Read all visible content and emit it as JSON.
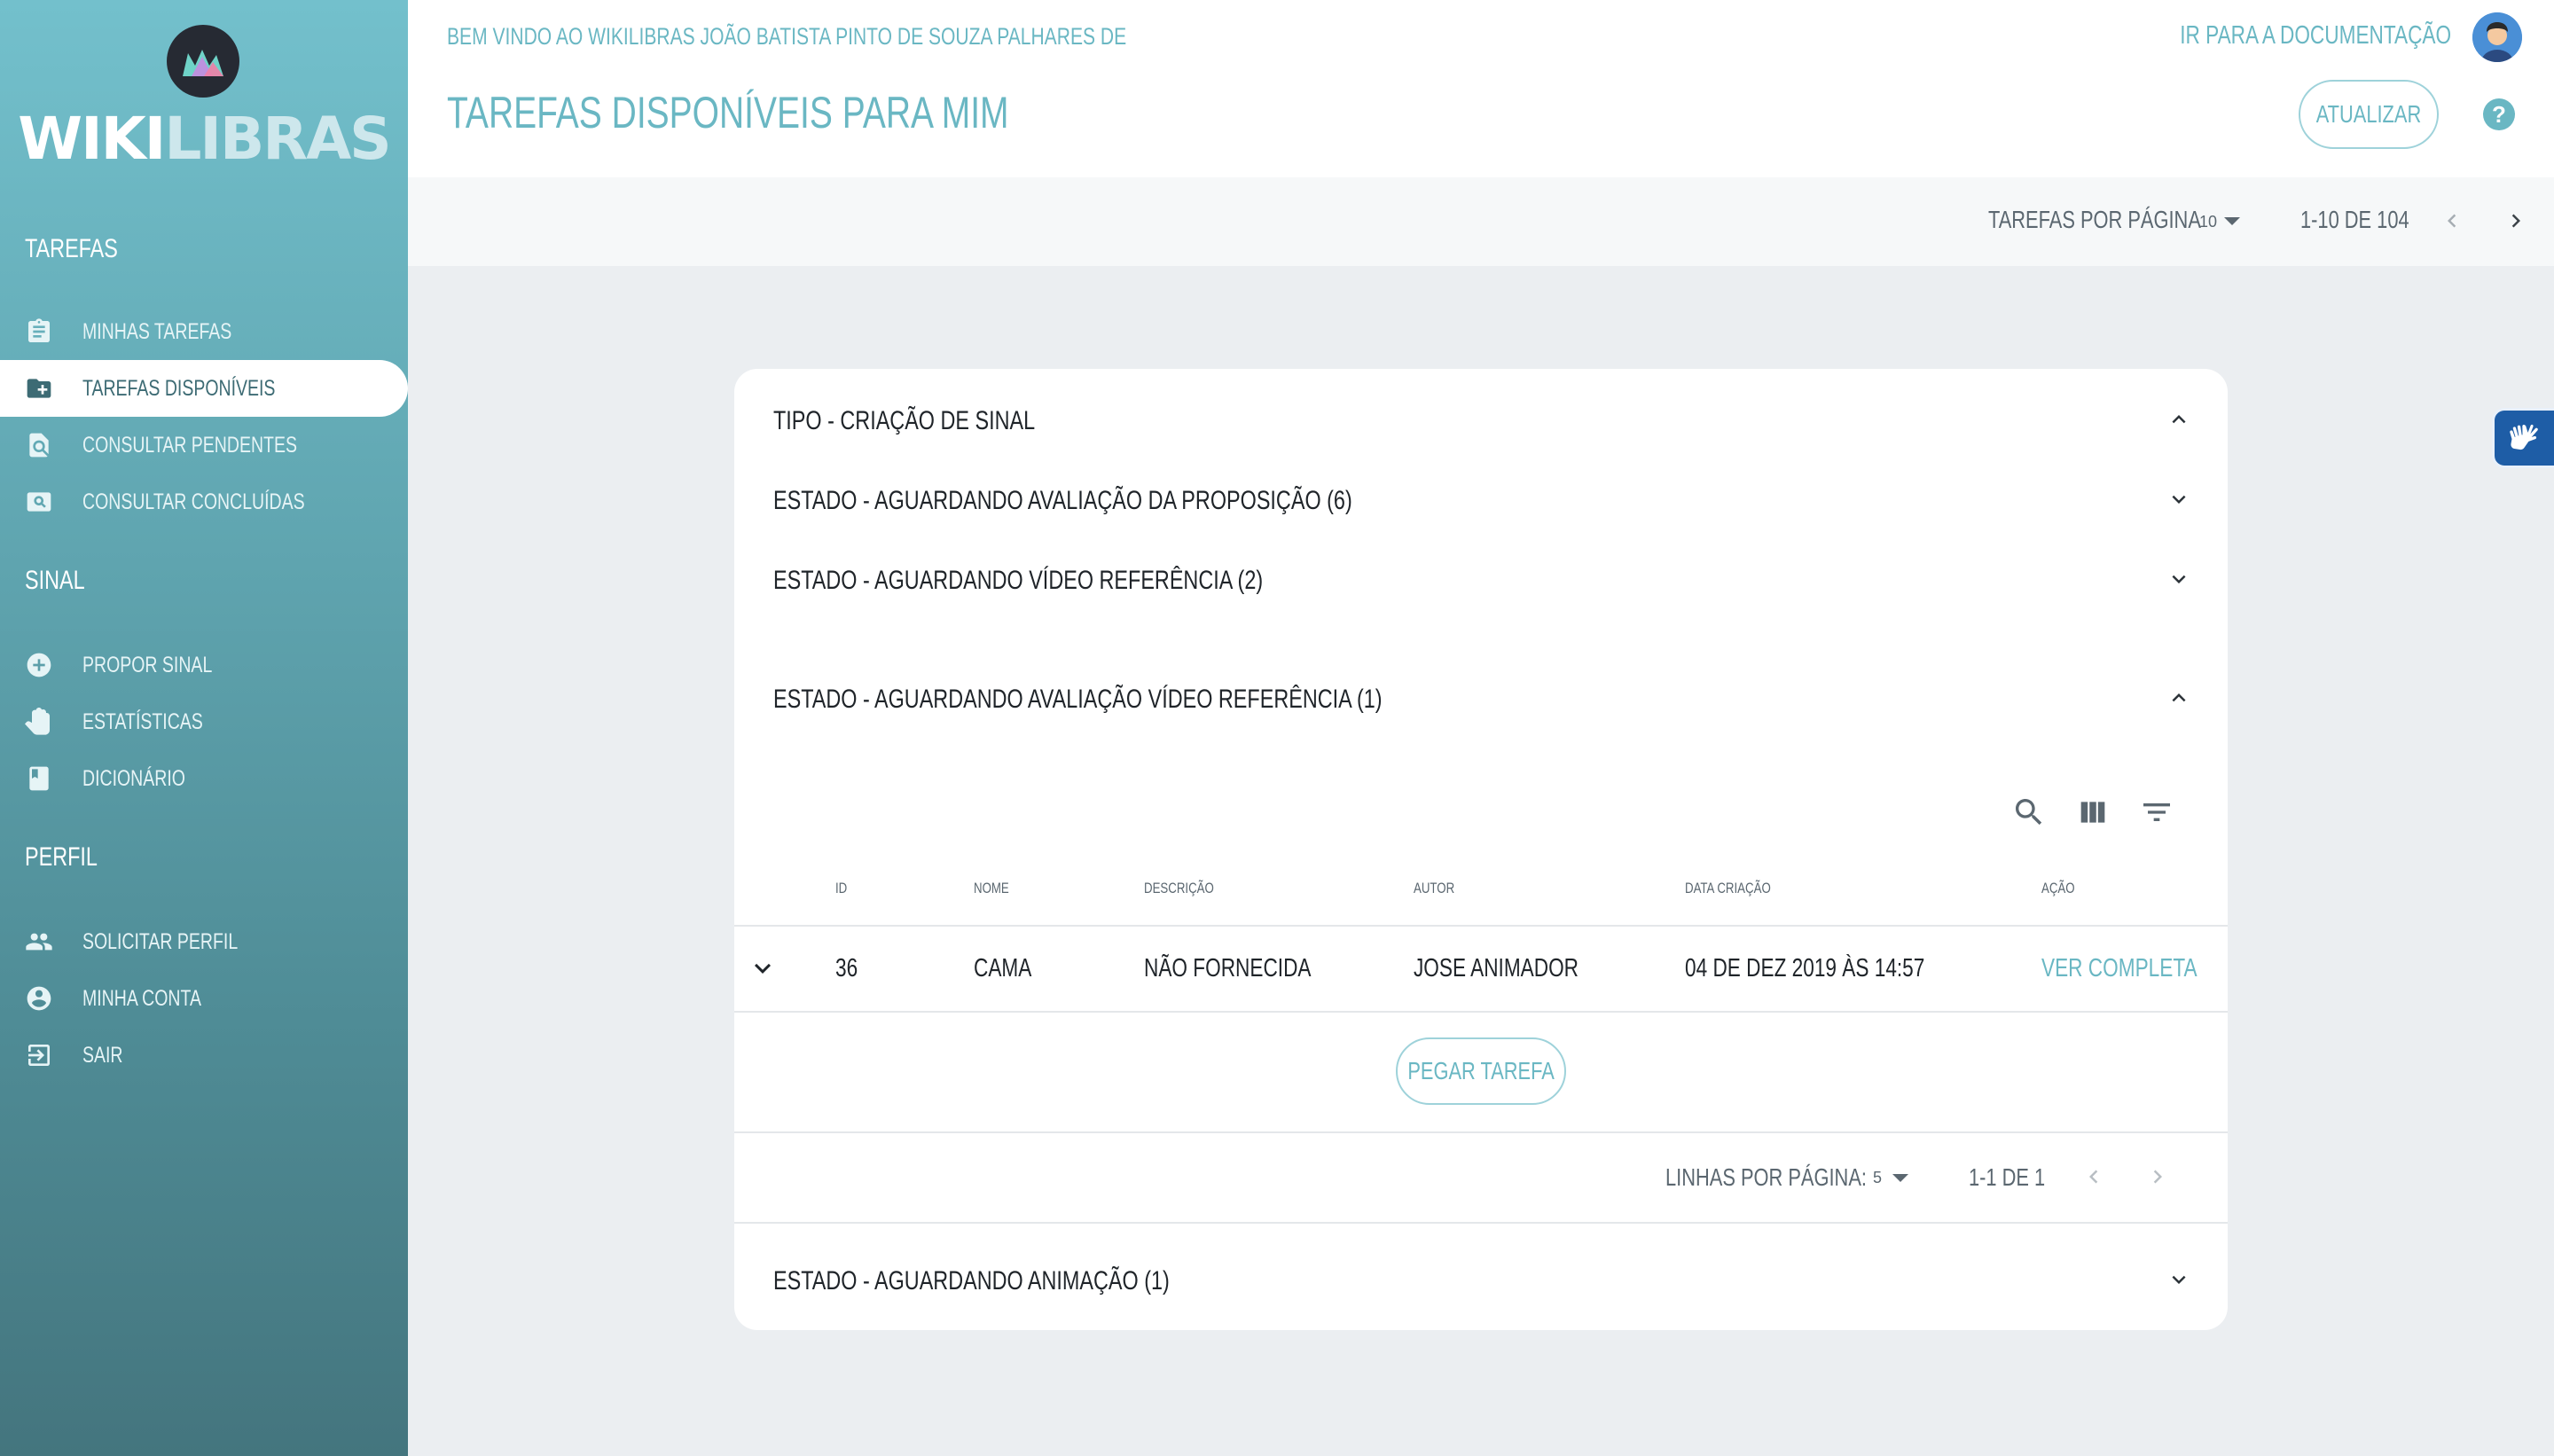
{
  "app": {
    "brand_part1": "WIKI",
    "brand_part2": "LIBRAS"
  },
  "sidebar": {
    "sections": [
      {
        "title": "Tarefas",
        "items": [
          {
            "label": "Minhas tarefas",
            "icon": "clipboard-icon"
          },
          {
            "label": "Tarefas disponíveis",
            "icon": "folder-plus-icon",
            "active": true
          },
          {
            "label": "Consultar pendentes",
            "icon": "find-in-page-icon"
          },
          {
            "label": "Consultar concluídas",
            "icon": "image-search-icon"
          }
        ]
      },
      {
        "title": "Sinal",
        "items": [
          {
            "label": "Propor sinal",
            "icon": "add-circle-icon"
          },
          {
            "label": "Estatísticas",
            "icon": "hand-icon"
          },
          {
            "label": "Dicionário",
            "icon": "book-icon"
          }
        ]
      },
      {
        "title": "Perfil",
        "items": [
          {
            "label": "Solicitar perfil",
            "icon": "people-icon"
          },
          {
            "label": "Minha conta",
            "icon": "account-circle-icon"
          },
          {
            "label": "Sair",
            "icon": "exit-icon"
          }
        ]
      }
    ]
  },
  "header": {
    "welcome": "Bem vindo ao WikiLibras João Batista Pinto de Souza Palhares de",
    "title": "Tarefas disponíveis para mim",
    "doc_link": "Ir para a documentação",
    "refresh_label": "Atualizar",
    "help": "?"
  },
  "pager": {
    "per_page_label": "Tarefas por página",
    "per_page_value": "10",
    "range": "1-10 de 104"
  },
  "card": {
    "type_title": "Tipo - Criação de sinal",
    "groups": [
      {
        "title": "Estado - Aguardando avaliação da proposição (6)",
        "expanded": false
      },
      {
        "title": "Estado - Aguardando vídeo referência (2)",
        "expanded": false
      },
      {
        "title": "Estado - Aguardando avaliação vídeo referência (1)",
        "expanded": true
      },
      {
        "title": "Estado - Aguardando animação (1)",
        "expanded": false
      }
    ],
    "table": {
      "columns": [
        "Id",
        "Nome",
        "Descrição",
        "Autor",
        "Data criação",
        "Ação"
      ],
      "rows": [
        {
          "id": "36",
          "nome": "Cama",
          "descricao": "Não fornecida",
          "autor": "Jose Animador",
          "data": "04 de dez 2019 às 14:57",
          "acao": "Ver completa"
        }
      ],
      "pick_label": "Pegar tarefa",
      "rows_per_page_label": "Linhas por página:",
      "rows_per_page_value": "5",
      "range": "1-1 de 1"
    }
  },
  "colors": {
    "accent": "#6ab7c3",
    "sidebar_top": "#73c0cc",
    "sidebar_bottom": "#44757e",
    "a11y": "#1e5da6"
  }
}
